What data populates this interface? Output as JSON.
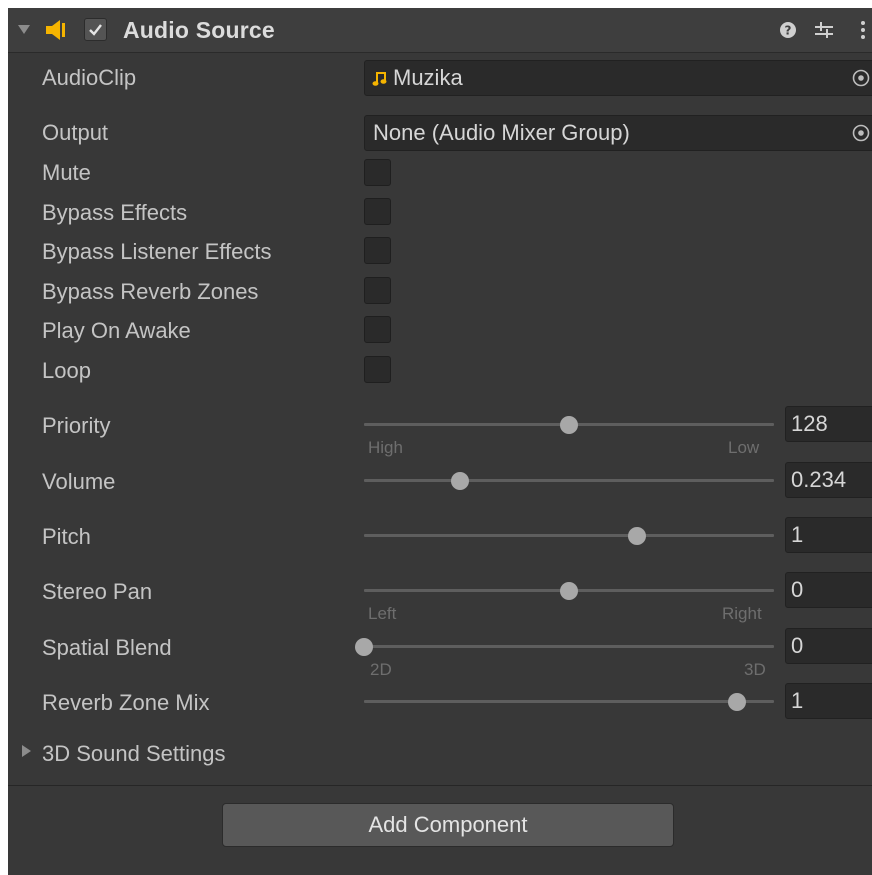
{
  "component": {
    "title": "Audio Source",
    "enabled": true,
    "icons": {
      "audio": "audio-source-icon",
      "help": "help-icon",
      "presets": "presets-icon",
      "more": "more-icon"
    }
  },
  "fields": {
    "audio_clip": {
      "label": "AudioClip",
      "value": "Muzika",
      "icon": "music-note-icon"
    },
    "output": {
      "label": "Output",
      "value": "None (Audio Mixer Group)"
    }
  },
  "toggles": [
    {
      "label": "Mute",
      "checked": false
    },
    {
      "label": "Bypass Effects",
      "checked": false
    },
    {
      "label": "Bypass Listener Effects",
      "checked": false
    },
    {
      "label": "Bypass Reverb Zones",
      "checked": false
    },
    {
      "label": "Play On Awake",
      "checked": false
    },
    {
      "label": "Loop",
      "checked": false
    }
  ],
  "sliders": {
    "priority": {
      "label": "Priority",
      "value": "128",
      "min": 0,
      "max": 256,
      "min_label": "High",
      "max_label": "Low"
    },
    "volume": {
      "label": "Volume",
      "value": "0.234",
      "min": 0,
      "max": 1
    },
    "pitch": {
      "label": "Pitch",
      "value": "1",
      "min": -3,
      "max": 3
    },
    "stereo_pan": {
      "label": "Stereo Pan",
      "value": "0",
      "min": -1,
      "max": 1,
      "min_label": "Left",
      "max_label": "Right"
    },
    "spatial_blend": {
      "label": "Spatial Blend",
      "value": "0",
      "min": 0,
      "max": 1,
      "min_label": "2D",
      "max_label": "3D"
    },
    "reverb_zone_mix": {
      "label": "Reverb Zone Mix",
      "value": "1",
      "min": 0,
      "max": 1.1
    }
  },
  "foldout": {
    "label": "3D Sound Settings",
    "expanded": false
  },
  "add_component_label": "Add Component",
  "colors": {
    "background": "#383838",
    "field": "#2a2a2a",
    "accent_icon": "#f5b400",
    "thumb": "#a8a8a8",
    "button": "#585858"
  }
}
